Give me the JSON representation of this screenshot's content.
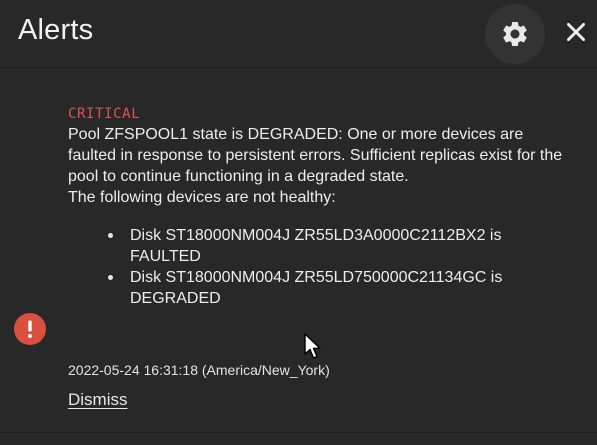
{
  "header": {
    "title": "Alerts",
    "settings_icon": "gear-icon",
    "close_icon": "close-icon"
  },
  "alert": {
    "level": "CRITICAL",
    "icon": "error-circle-icon",
    "message_lines": [
      "Pool ZFSPOOL1 state is DEGRADED: One or more devices are faulted in response to persistent errors. Sufficient replicas exist for the pool to continue functioning in a degraded state.",
      "The following devices are not healthy:"
    ],
    "devices": [
      "Disk ST18000NM004J ZR55LD3A0000C2112BX2 is FAULTED",
      "Disk ST18000NM004J ZR55LD750000C21134GC is DEGRADED"
    ],
    "timestamp": "2022-05-24 16:31:18 (America/New_York)",
    "dismiss_label": "Dismiss"
  },
  "colors": {
    "background": "#282828",
    "critical": "#d6574a",
    "icon_bg": "#d9503f",
    "text": "#ededed"
  }
}
